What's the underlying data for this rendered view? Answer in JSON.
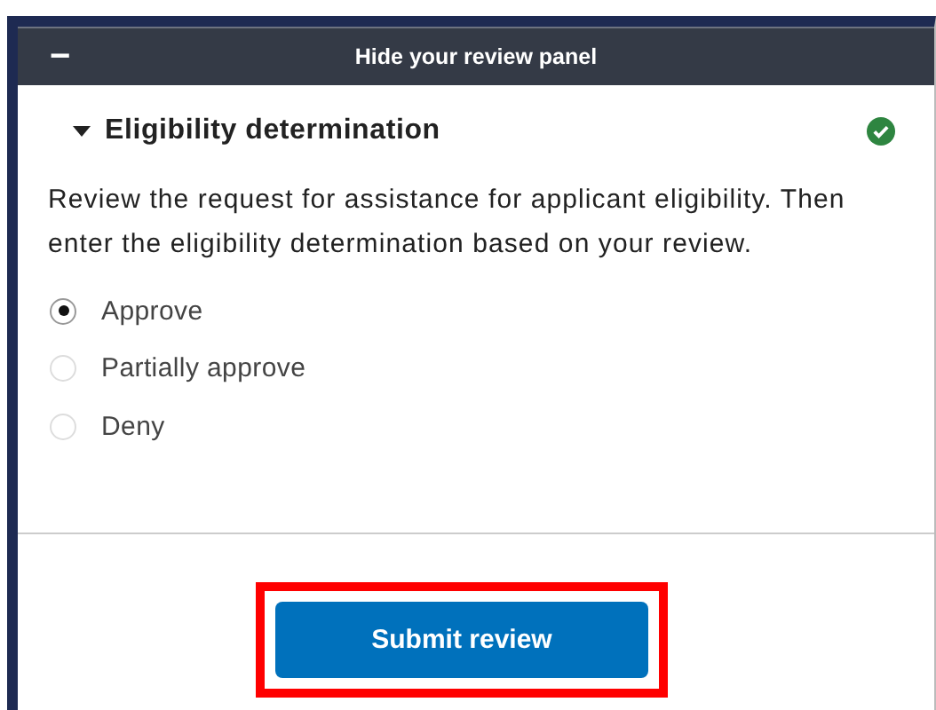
{
  "panel_header": {
    "title": "Hide your review panel",
    "collapse_icon": "−"
  },
  "section": {
    "title": "Eligibility determination",
    "expanded": true,
    "complete": true,
    "instructions": "Review the request for assistance for applicant eligibility. Then enter the eligibility determination based on your review.",
    "options": [
      {
        "label": "Approve",
        "selected": true
      },
      {
        "label": "Partially approve",
        "selected": false
      },
      {
        "label": "Deny",
        "selected": false
      }
    ]
  },
  "submit_button": {
    "label": "Submit review",
    "highlighted": true
  }
}
